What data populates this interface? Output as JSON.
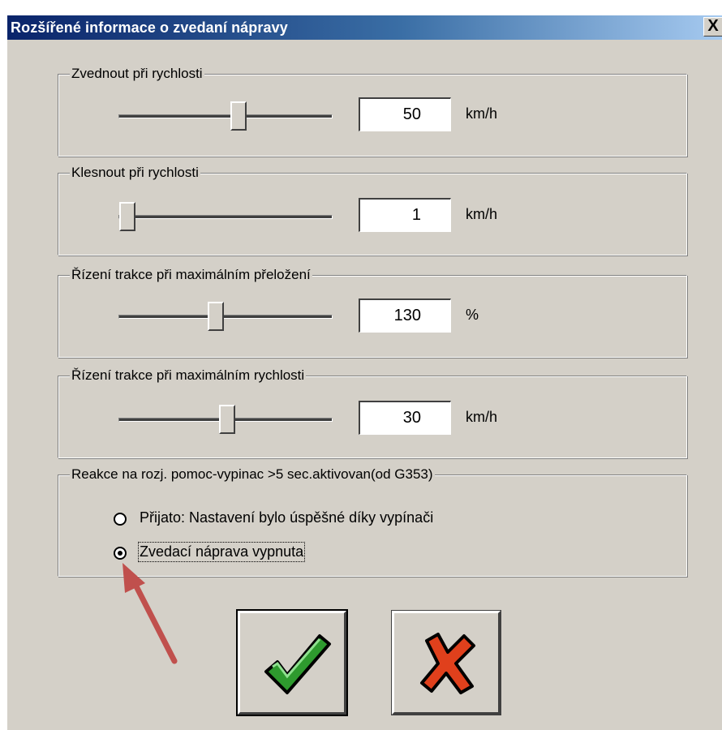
{
  "window": {
    "title": "Rozšířené informace o zvedaní nápravy",
    "close_label": "X"
  },
  "groups": [
    {
      "legend": "Zvednout při rychlosti",
      "value": "50",
      "unit": "km/h",
      "slider_fraction": 0.56
    },
    {
      "legend": "Klesnout při rychlosti",
      "value": "1",
      "unit": "km/h",
      "slider_fraction": 0.02
    },
    {
      "legend": "Řízení trakce při maximálním přeložení",
      "value": "130",
      "unit": "%",
      "slider_fraction": 0.45
    },
    {
      "legend": "Řízení trakce při maximálním rychlosti",
      "value": "30",
      "unit": "km/h",
      "slider_fraction": 0.52
    }
  ],
  "reaction": {
    "legend": "Reakce na rozj. pomoc-vypinac >5 sec.aktivovan(od G353)",
    "options": [
      {
        "label": "Přijato: Nastavení bylo úspěšné díky vypínači",
        "selected": false
      },
      {
        "label": "Zvedací náprava vypnuta",
        "selected": true
      }
    ]
  },
  "buttons": {
    "ok_icon": "green-checkmark-icon",
    "cancel_icon": "red-x-icon"
  },
  "colors": {
    "dialog_bg": "#d4d0c8",
    "title_start": "#0a246a",
    "title_end": "#a6caf0",
    "check_green": "#2e9a2e",
    "cross_red": "#e0401c",
    "annotation_arrow": "#c0504d"
  },
  "annotation": {
    "type": "arrow",
    "points_to": "radio-option-zvedaci-naprava-vypnuta"
  }
}
